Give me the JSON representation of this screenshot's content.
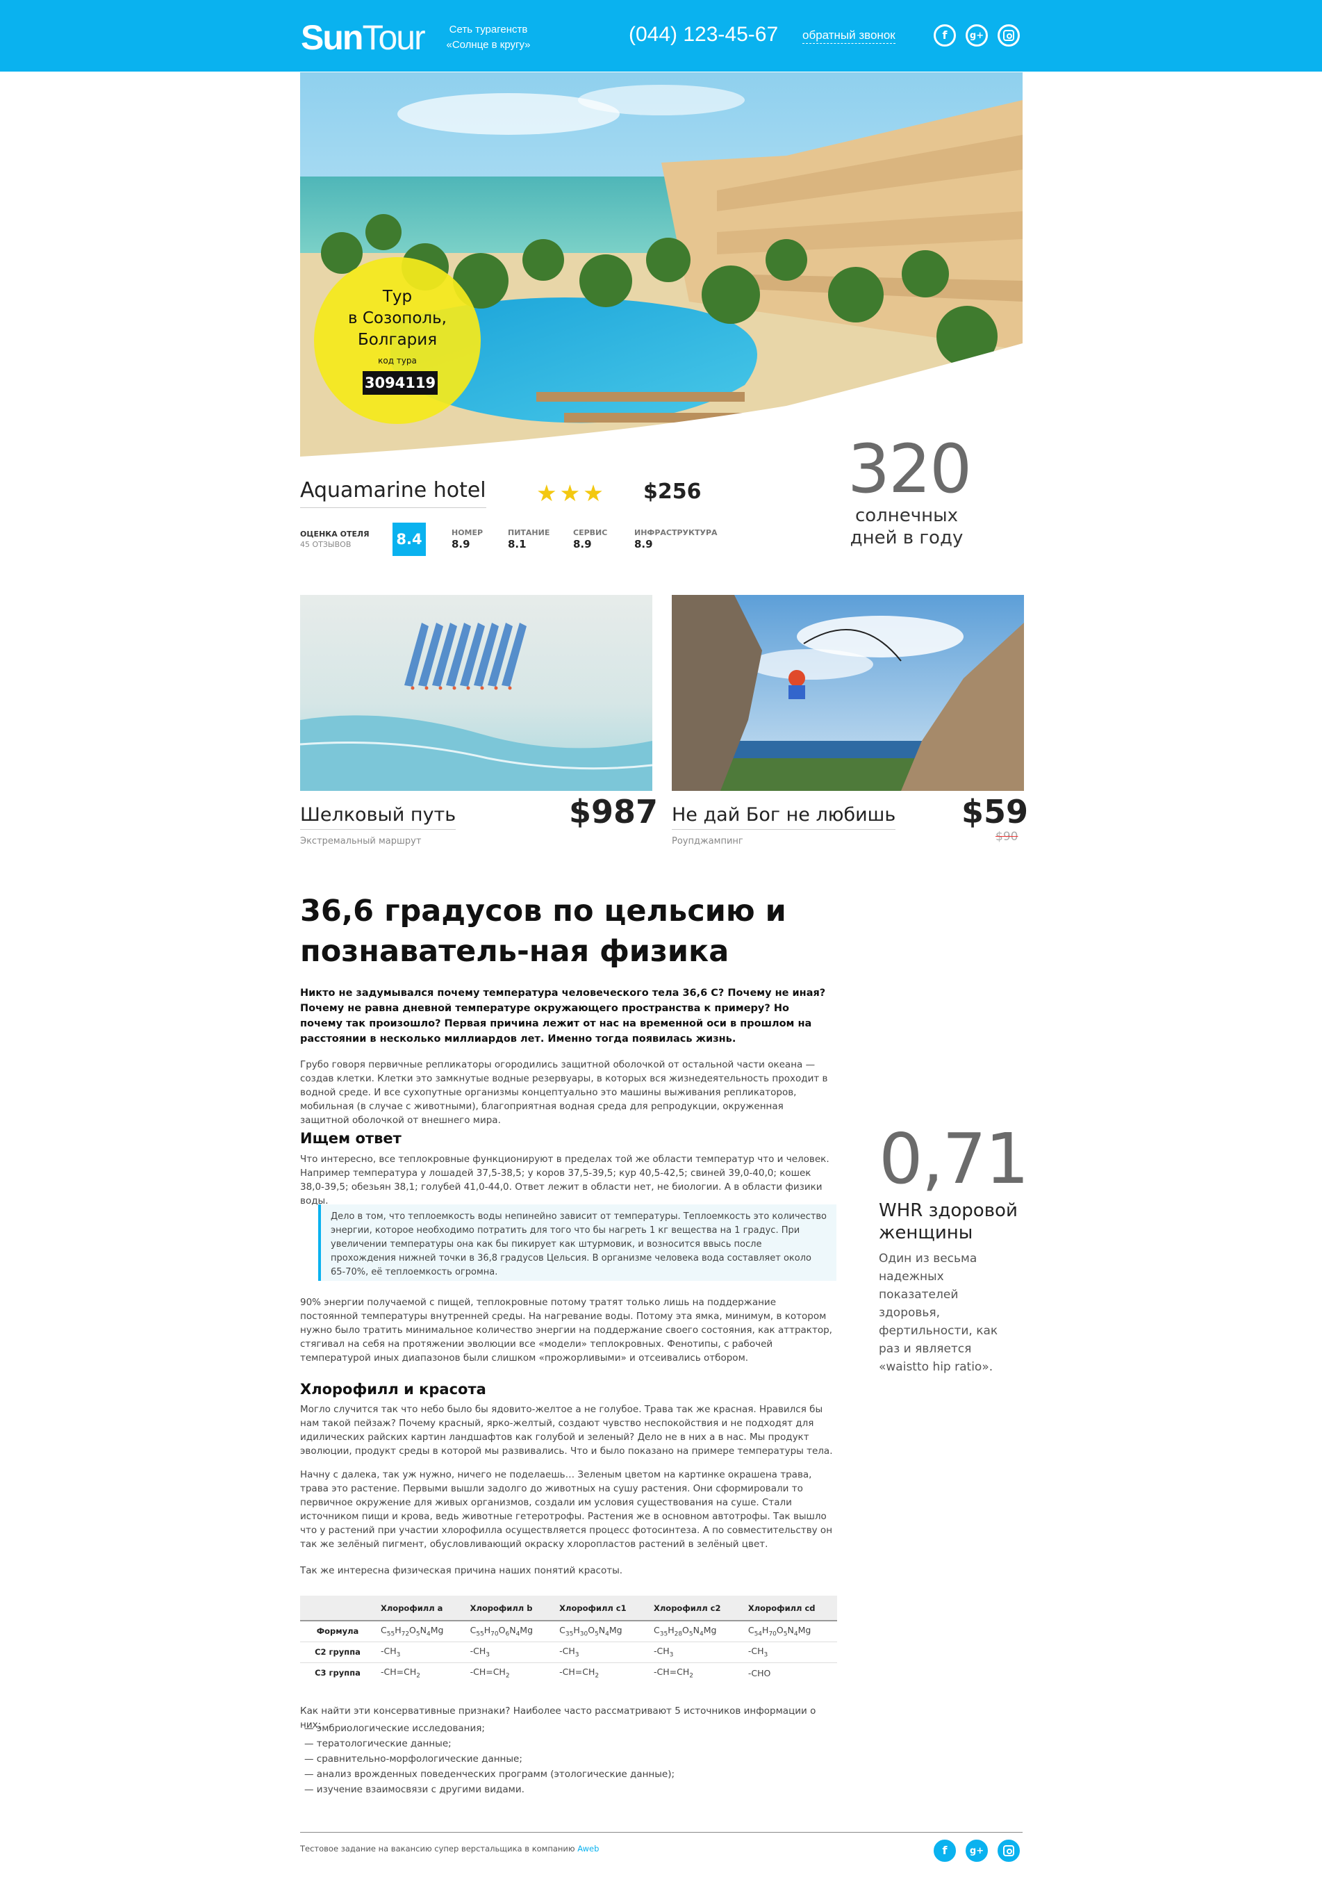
{
  "header": {
    "logo_bold": "Sun",
    "logo_light": "Tour",
    "tagline": "Сеть турагенств «Солнце в кругу»",
    "phone": "(044) 123-45-67",
    "callback": "обратный звонок",
    "social": [
      "facebook-icon",
      "google-plus-icon",
      "instagram-icon"
    ]
  },
  "hero": {
    "badge_title": "Тур\nв Созополь,\nБолгария",
    "code_label": "код тура",
    "code": "3094119"
  },
  "hotel": {
    "name": "Aquamarine hotel",
    "stars": 3,
    "price": "$256",
    "rating_label": "ОЦЕНКА ОТЕЛЯ",
    "reviews": "45 ОТЗЫВОВ",
    "score": "8.4",
    "subratings": [
      {
        "label": "НОМЕР",
        "value": "8.9"
      },
      {
        "label": "ПИТАНИЕ",
        "value": "8.1"
      },
      {
        "label": "СЕРВИС",
        "value": "8.9"
      },
      {
        "label": "ИНФРАСТРУКТУРА",
        "value": "8.9"
      }
    ]
  },
  "sunny": {
    "number": "320",
    "text": "солнечных дней в году"
  },
  "cards": [
    {
      "title": "Шелковый путь",
      "subtitle": "Экстремальный маршрут",
      "price": "$987",
      "old_price": ""
    },
    {
      "title": "Не дай Бог не любишь",
      "subtitle": "Роупджампинг",
      "price": "$59",
      "old_price": "$90"
    }
  ],
  "article": {
    "title": "36,6 градусов по цельсию и познаватель-ная физика",
    "lead": "Никто не задумывался почему температура человеческого тела 36,6 С? Почему не иная? Почему не равна дневной температуре окружающего пространства к примеру? Но почему так произошло? Первая причина лежит от нас на временной оси в прошлом на расстоянии в несколько миллиардов лет. Именно тогда появилась жизнь.",
    "p1": "Грубо говоря первичные репликаторы огородились защитной оболочкой от остальной части океана — создав клетки. Клетки это замкнутые водные резервуары, в которых вся жизнедеятельность проходит в водной среде. И все сухопутные организмы концептуально это машины выживания репликаторов, мобильная (в случае с животными), благоприятная водная среда для репродукции, окруженная защитной оболочкой от внешнего мира.",
    "h_answer": "Ищем ответ",
    "p2": "Что интересно, все теплокровные функционируют в пределах той же области температур что и человек. Например температура у лошадей 37,5-38,5; у коров 37,5-39,5; кур 40,5-42,5; свиней 39,0-40,0; кошек 38,0-39,5; обезьян 38,1; голубей 41,0-44,0. Ответ лежит в области нет, не биологии. А в области физики воды.",
    "quote": "Дело в том, что теплоемкость воды непинейно зависит от температуры. Теплоемкость это количество энергии, которое необходимо потратить для того что бы нагреть 1 кг вещества на 1 градус. При увеличении температуры она как бы пикирует как штурмовик, и возносится ввысь после прохождения нижней точки в 36,8 градусов Цельсия. В организме человека вода составляет около 65-70%, её теплоемкость огромна.",
    "p3": "90% энергии получаемой с пищей, теплокровные потому тратят только лишь на поддержание постоянной температуры внутренней среды. На нагревание воды. Потому эта ямка, минимум, в котором нужно было тратить минимальное количество энергии на поддержание своего состояния, как аттрактор, стягивал на себя на протяжении эволюции все «модели» теплокровных. Фенотипы, с рабочей температурой иных диапазонов были слишком «прожорливыми» и отсеивались отбором.",
    "h_chloro": "Хлорофилл и красота",
    "p4": "Могло случится так что небо было бы ядовито-желтое а не голубое. Трава так же красная. Нравился бы нам такой пейзаж? Почему красный, ярко-желтый, создают чувство неспокойствия и не подходят для идилических райских картин ландшафтов как голубой и зеленый? Дело не в них а в нас. Мы продукт эволюции, продукт среды в которой мы развивались. Что и было показано на примере температуры тела.",
    "p5": "Начну с далека, так уж нужно, ничего не поделаешь… Зеленым цветом на картинке окрашена трава, трава это растение. Первыми вышли задолго до животных на сушу растения. Они сформировали то первичное окружение для живых организмов, создали им условия существования на суше. Стали источником пищи и крова, ведь животные гетеротрофы. Растения же в основном автотрофы. Так вышло что у растений при участии хлорофилла осуществляется процесс фотосинтеза. А по совместительству он так же зелёный пигмент, обусловливающий окраску хлоропластов растений в зелёный цвет.",
    "p6": "Так же интересна физическая причина наших понятий красоты.",
    "p7": "Как найти эти консервативные признаки? Наиболее часто рассматривают 5 источников информации о них:",
    "list": [
      "— эмбриологические исследования;",
      "— тератологические данные;",
      "— сравнительно-морфологические данные;",
      "— анализ врожденных поведенческих программ (этологические данные);",
      "— изучение взаимосвязи с другими видами."
    ]
  },
  "whr": {
    "number": "0,71",
    "title": "WHR здоровой женщины",
    "desc": "Один из весьма надежных показателей здоровья, фертильности, как раз и является «waistto hip ratio»."
  },
  "table": {
    "headers": [
      "",
      "Хлорофилл a",
      "Хлорофилл b",
      "Хлорофилл c1",
      "Хлорофилл c2",
      "Хлорофилл cd"
    ],
    "rows": [
      {
        "label": "Формула",
        "cells": [
          [
            "C",
            "55",
            "H",
            "72",
            "O",
            "5",
            "N",
            "4",
            "Mg"
          ],
          [
            "C",
            "55",
            "H",
            "70",
            "O",
            "6",
            "N",
            "4",
            "Mg"
          ],
          [
            "C",
            "35",
            "H",
            "30",
            "O",
            "5",
            "N",
            "4",
            "Mg"
          ],
          [
            "C",
            "35",
            "H",
            "28",
            "O",
            "5",
            "N",
            "4",
            "Mg"
          ],
          [
            "C",
            "54",
            "H",
            "70",
            "O",
            "5",
            "N",
            "4",
            "Mg"
          ]
        ]
      },
      {
        "label": "C2 группа",
        "cells": [
          [
            "-CH",
            "3"
          ],
          [
            "-CH",
            "3"
          ],
          [
            "-CH",
            "3"
          ],
          [
            "-CH",
            "3"
          ],
          [
            "-CH",
            "3"
          ]
        ]
      },
      {
        "label": "C3 группа",
        "cells": [
          [
            "-CH=CH",
            "2"
          ],
          [
            "-CH=CH",
            "2"
          ],
          [
            "-CH=CH",
            "2"
          ],
          [
            "-CH=CH",
            "2"
          ],
          [
            "-CHO"
          ]
        ]
      }
    ]
  },
  "footer": {
    "text": "Тестовое задание на вакансию супер верстальщика в компанию",
    "link": "Aweb"
  },
  "colors": {
    "accent": "#0ab2ef",
    "badge": "#f4e91c",
    "star": "#f3c811"
  }
}
